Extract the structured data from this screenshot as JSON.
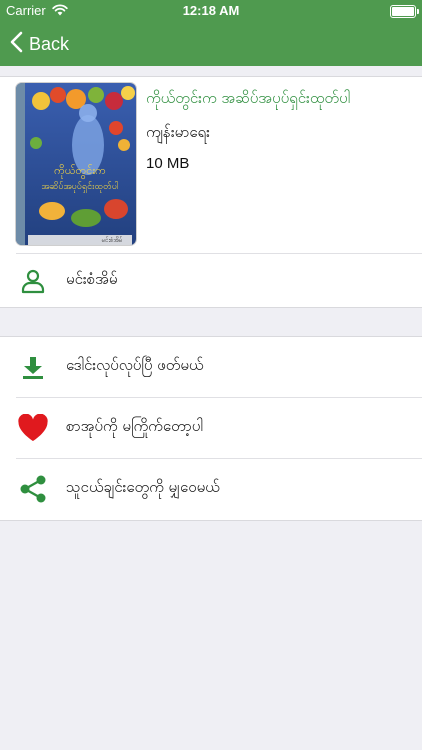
{
  "status": {
    "carrier": "Carrier",
    "time": "12:18 AM"
  },
  "nav": {
    "back_label": "Back"
  },
  "book": {
    "title": "ကိုယ်တွင်းက အဆိပ်အပုပ်ရှင်းထုတ်ပါ",
    "category": "ကျန်းမာရေး",
    "size": "10 MB",
    "cover_title_1": "ကိုယ်တွင်းက",
    "cover_title_2": "အဆိပ်အပုပ်ရှင်းထုတ်ပါ",
    "cover_author": "မင်းစံအိမ်"
  },
  "author_row": {
    "label": "မင်းစံအိမ်",
    "icon": "person-icon"
  },
  "actions": [
    {
      "label": "ဒေါင်းလုပ်လုပ်ပြီ ဖတ်မယ်",
      "icon": "download-icon"
    },
    {
      "label": "စာအုပ်ကို မကြိုက်တော့ပါ",
      "icon": "heart-icon"
    },
    {
      "label": "သူငယ်ချင်းတွေကို မျှဝေမယ်",
      "icon": "share-icon"
    }
  ],
  "colors": {
    "nav_bg": "#4f9a4f",
    "accent_green": "#2f8f3f",
    "heart_red": "#e0191e",
    "background": "#efeff4"
  }
}
